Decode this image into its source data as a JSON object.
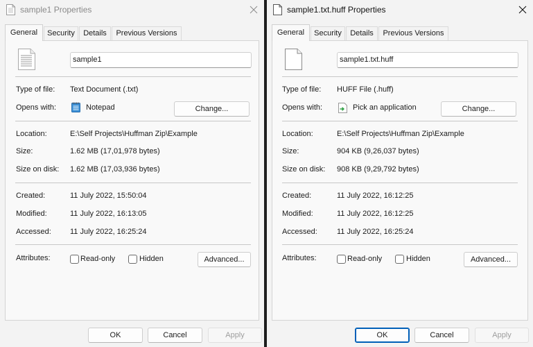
{
  "left": {
    "title": "sample1 Properties",
    "tabs": [
      "General",
      "Security",
      "Details",
      "Previous Versions"
    ],
    "file_name": "sample1",
    "type_label": "Type of file:",
    "type_value": "Text Document (.txt)",
    "opens_label": "Opens with:",
    "opens_value": "Notepad",
    "change_label": "Change...",
    "location_label": "Location:",
    "location_value": "E:\\Self Projects\\Huffman Zip\\Example",
    "size_label": "Size:",
    "size_value": "1.62 MB (17,01,978 bytes)",
    "size_on_disk_label": "Size on disk:",
    "size_on_disk_value": "1.62 MB (17,03,936 bytes)",
    "created_label": "Created:",
    "created_value": "11 July 2022, 15:50:04",
    "modified_label": "Modified:",
    "modified_value": "11 July 2022, 16:13:05",
    "accessed_label": "Accessed:",
    "accessed_value": "11 July 2022, 16:25:24",
    "attributes_label": "Attributes:",
    "readonly_label": "Read-only",
    "hidden_label": "Hidden",
    "advanced_label": "Advanced...",
    "ok_label": "OK",
    "cancel_label": "Cancel",
    "apply_label": "Apply",
    "icons": {
      "title": "document-icon",
      "file": "text-document-icon",
      "app": "notepad-icon"
    }
  },
  "right": {
    "title": "sample1.txt.huff Properties",
    "tabs": [
      "General",
      "Security",
      "Details",
      "Previous Versions"
    ],
    "file_name": "sample1.txt.huff",
    "type_label": "Type of file:",
    "type_value": "HUFF File (.huff)",
    "opens_label": "Opens with:",
    "opens_value": "Pick an application",
    "change_label": "Change...",
    "location_label": "Location:",
    "location_value": "E:\\Self Projects\\Huffman Zip\\Example",
    "size_label": "Size:",
    "size_value": "904 KB (9,26,037 bytes)",
    "size_on_disk_label": "Size on disk:",
    "size_on_disk_value": "908 KB (9,29,792 bytes)",
    "created_label": "Created:",
    "created_value": "11 July 2022, 16:12:25",
    "modified_label": "Modified:",
    "modified_value": "11 July 2022, 16:12:25",
    "accessed_label": "Accessed:",
    "accessed_value": "11 July 2022, 16:25:24",
    "attributes_label": "Attributes:",
    "readonly_label": "Read-only",
    "hidden_label": "Hidden",
    "advanced_label": "Advanced...",
    "ok_label": "OK",
    "cancel_label": "Cancel",
    "apply_label": "Apply",
    "icons": {
      "title": "blank-file-icon",
      "file": "blank-file-icon",
      "app": "pick-application-icon"
    }
  },
  "colors": {
    "accent": "#005fb8",
    "dialog_bg": "#f3f3f3",
    "panel_bg": "#f9f9f9",
    "backdrop": "#1d1d1d"
  }
}
